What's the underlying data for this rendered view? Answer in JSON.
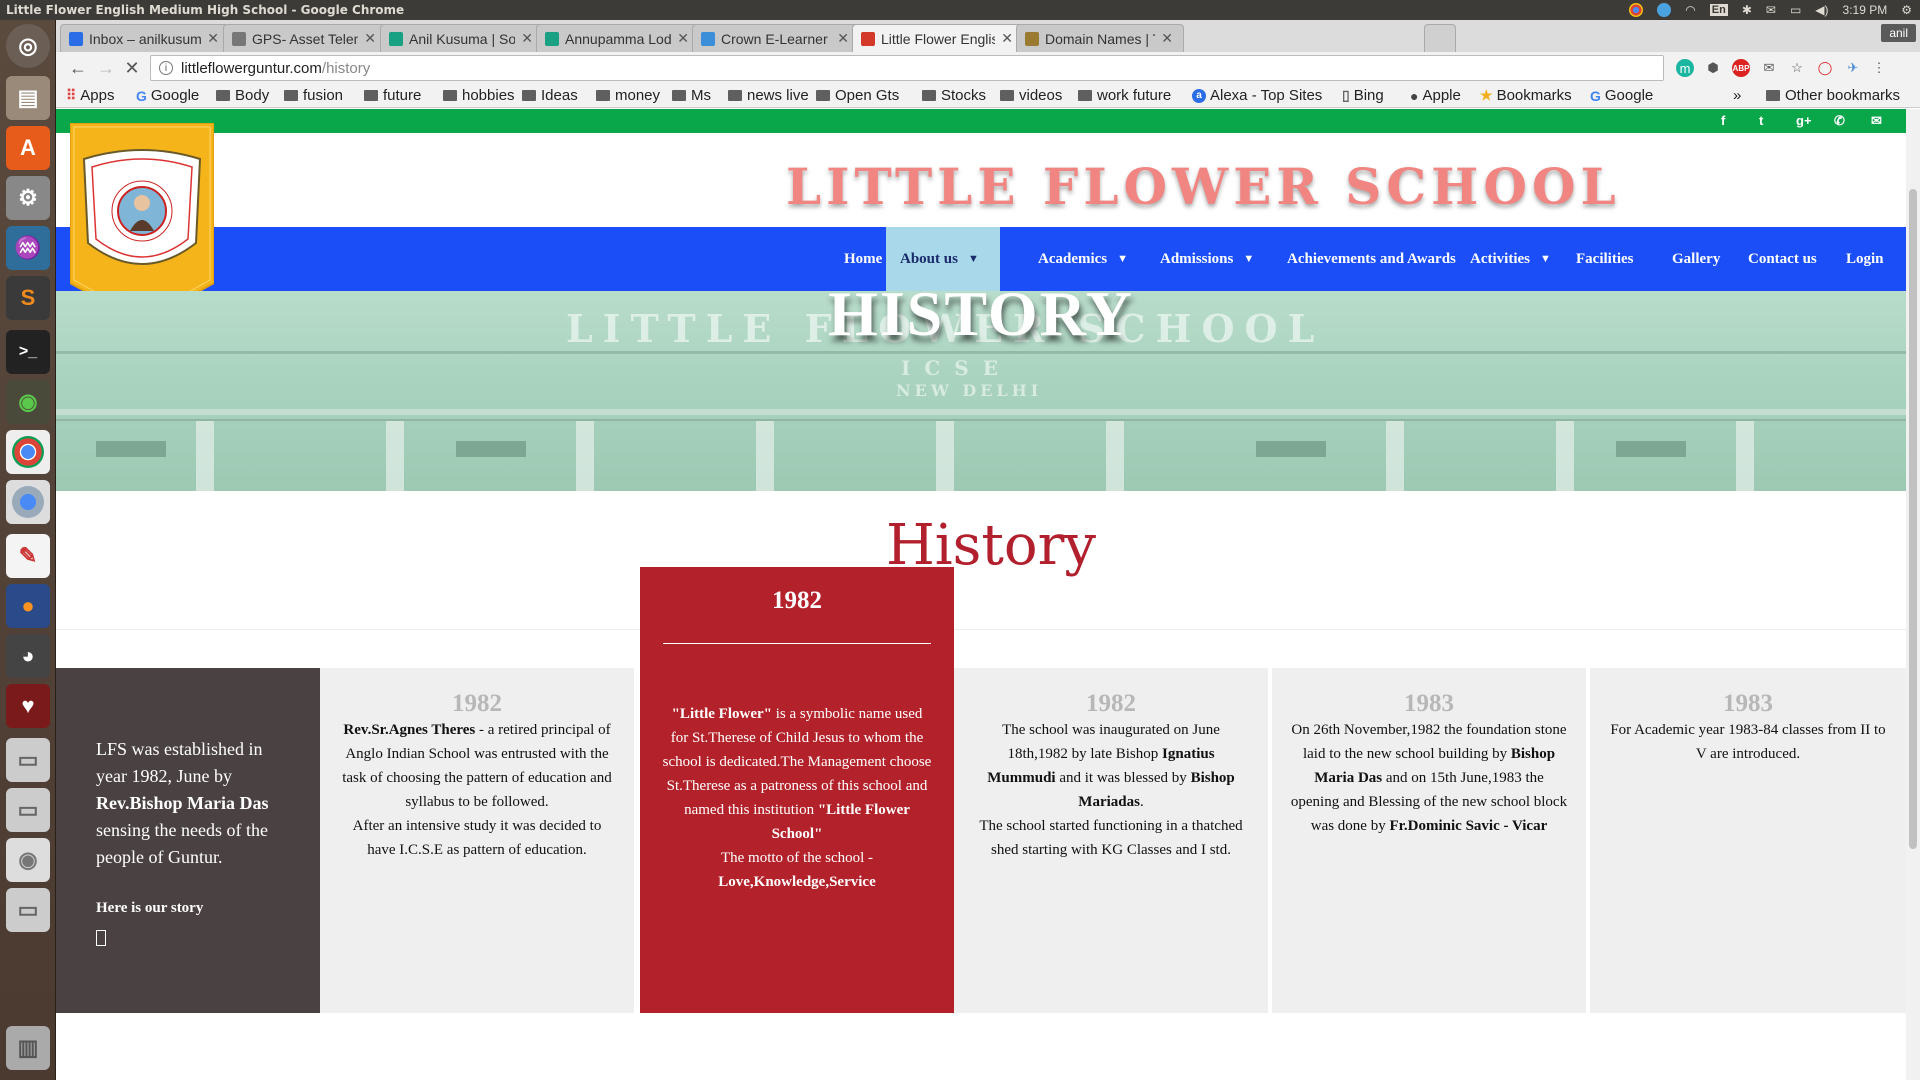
{
  "os": {
    "window_title": "Little Flower English Medium High School - Google Chrome",
    "keyboard": "En",
    "clock": "3:19 PM"
  },
  "browser": {
    "tabs": [
      {
        "label": "Inbox – anilkusuma",
        "favicon_color": "#2b6de6",
        "active": false
      },
      {
        "label": "GPS- Asset Telemat",
        "favicon_color": "#777777",
        "active": false
      },
      {
        "label": "Anil Kusuma | Softw",
        "favicon_color": "#1aa083",
        "active": false
      },
      {
        "label": "Annupamma Lodge",
        "favicon_color": "#1aa083",
        "active": false
      },
      {
        "label": "Crown E-Learner - A",
        "favicon_color": "#3b8fd9",
        "active": false
      },
      {
        "label": "Little Flower Englis",
        "favicon_color": "#d33a2a",
        "active": true
      },
      {
        "label": "Domain Names | Th",
        "favicon_color": "#9a7a30",
        "active": false
      }
    ],
    "user": "anil",
    "url_host": "littleflowerguntur.com",
    "url_path": "/history",
    "bookmarks": [
      {
        "label": "Apps",
        "icon": "apps-grid-icon"
      },
      {
        "label": "Google",
        "icon": "google-icon"
      },
      {
        "label": "Body",
        "icon": "folder-icon"
      },
      {
        "label": "fusion",
        "icon": "folder-icon"
      },
      {
        "label": "future",
        "icon": "folder-icon"
      },
      {
        "label": "hobbies",
        "icon": "folder-icon"
      },
      {
        "label": "Ideas",
        "icon": "folder-icon"
      },
      {
        "label": "money",
        "icon": "folder-icon"
      },
      {
        "label": "Ms",
        "icon": "folder-icon"
      },
      {
        "label": "news live",
        "icon": "folder-icon"
      },
      {
        "label": "Open Gts",
        "icon": "folder-icon"
      },
      {
        "label": "Stocks",
        "icon": "folder-icon"
      },
      {
        "label": "videos",
        "icon": "folder-icon"
      },
      {
        "label": "work future",
        "icon": "folder-icon"
      },
      {
        "label": "Alexa - Top Sites",
        "icon": "alexa-icon"
      },
      {
        "label": "Bing",
        "icon": "page-icon"
      },
      {
        "label": "Apple",
        "icon": "apple-icon"
      },
      {
        "label": "Bookmarks",
        "icon": "star-icon"
      },
      {
        "label": "Google",
        "icon": "google-icon"
      }
    ],
    "bookmarks_overflow": "»",
    "other_bookmarks": "Other bookmarks"
  },
  "site": {
    "school_name": "LITTLE FLOWER SCHOOL",
    "nav": [
      {
        "label": "Home",
        "dropdown": false,
        "active": false
      },
      {
        "label": "About us",
        "dropdown": true,
        "active": true
      },
      {
        "label": "Academics",
        "dropdown": true,
        "active": false
      },
      {
        "label": "Admissions",
        "dropdown": true,
        "active": false
      },
      {
        "label": "Achievements and Awards",
        "dropdown": false,
        "active": false
      },
      {
        "label": "Activities",
        "dropdown": true,
        "active": false
      },
      {
        "label": "Facilities",
        "dropdown": false,
        "active": false
      },
      {
        "label": "Gallery",
        "dropdown": false,
        "active": false
      },
      {
        "label": "Contact us",
        "dropdown": false,
        "active": false
      },
      {
        "label": "Login",
        "dropdown": false,
        "active": false
      }
    ],
    "social_icons": [
      "facebook-icon",
      "twitter-icon",
      "google-plus-icon",
      "phone-icon",
      "mail-icon"
    ],
    "banner": {
      "heading": "HISTORY",
      "building_text": "LITTLE FLOWER SCHOOL",
      "building_subtext": "ICSE",
      "building_subtext2": "NEW DELHI"
    },
    "section_heading": "History",
    "intro": {
      "text_part1": "LFS was established in year 1982, June by",
      "text_bold": "Rev.Bishop Maria Das",
      "text_part2": "sensing the needs of the people of Guntur.",
      "story_label": "Here is our story"
    },
    "featured": {
      "year": "1982",
      "quote": "\"Little Flower\"",
      "body1": " is a symbolic name used for St.Therese of Child Jesus to whom the school is dedicated.The Management choose St.Therese as a patroness of this school and named this institution ",
      "institution": "\"Little Flower School\"",
      "motto_label": "The motto of the school -",
      "motto": "Love,Knowledge,Service"
    },
    "card1": {
      "year": "1982",
      "bold1": "Rev.Sr.Agnes Theres",
      "text1": " - a retired principal of Anglo Indian School was entrusted with the task of choosing the pattern of education and syllabus to be followed.",
      "text2": "After an intensive study it was decided to have I.C.S.E as pattern of education."
    },
    "card3": {
      "year": "1982",
      "text1": "The school was inaugurated on June 18th,1982 by late Bishop ",
      "bold1": "Ignatius Mummudi",
      "text2": " and it was blessed by ",
      "bold2": "Bishop Mariadas",
      "text3": ".",
      "text4": "The school started functioning in a thatched shed starting with KG Classes and I std."
    },
    "card4": {
      "year": "1983",
      "text1": "On 26th November,1982 the foundation stone laid to the new school building by ",
      "bold1": "Bishop Maria Das",
      "text2": " and on 15th June,1983 the opening and Blessing of the new school block was done by ",
      "bold2": "Fr.Dominic Savic - Vicar"
    },
    "card5": {
      "year": "1983",
      "text1": "For Academic year 1983-84 classes from II to V are introduced."
    }
  }
}
